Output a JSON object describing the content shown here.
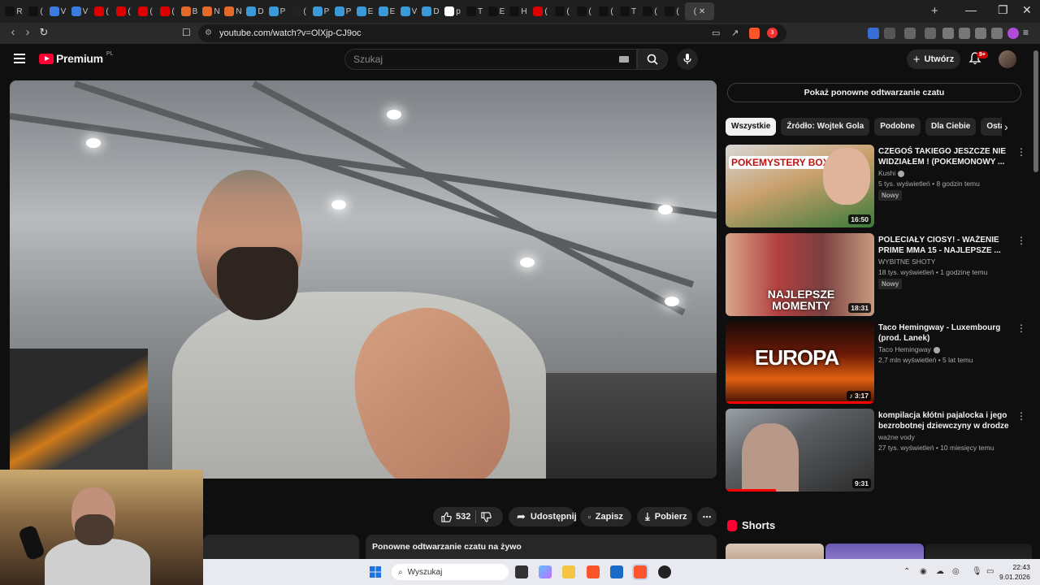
{
  "browser": {
    "active_tab_label": "(",
    "tab_initials": [
      "R",
      "(",
      "V",
      "V",
      "(",
      "(",
      "(",
      "(",
      "B",
      "N",
      "N",
      "D",
      "P",
      "(",
      "P",
      "P",
      "E",
      "E",
      "V",
      "D",
      "p",
      "T",
      "E",
      "H",
      "(",
      "(",
      "(",
      "(",
      "T",
      "(",
      "("
    ],
    "url": "youtube.com/watch?v=OlXjp-CJ9oc",
    "new_tab": "+",
    "win_min": "—",
    "win_max": "❐",
    "win_close": "✕",
    "ext_badge": "3"
  },
  "youtube": {
    "logo_text": "Premium",
    "logo_region": "PL",
    "search_placeholder": "Szukaj",
    "create_label": "Utwórz",
    "notifications_badge": "9+"
  },
  "video_actions": {
    "likes": "532",
    "share_label": "Udostępnij",
    "save_label": "Zapisz",
    "download_label": "Pobierz"
  },
  "chat": {
    "show_replay_button": "Pokaż ponowne odtwarzanie czatu",
    "replay_header": "Ponowne odtwarzanie czatu na żywo"
  },
  "filters": {
    "chips": [
      "Wszystkie",
      "Źródło: Wojtek Gola",
      "Podobne",
      "Dla Ciebie",
      "Ostatnio"
    ],
    "active": 0
  },
  "recommendations": [
    {
      "title": "CZEGOŚ TAKIEGO JESZCZE NIE WIDZIAŁEM ! (POKEMONOWY ...",
      "channel": "Kushi",
      "verified": true,
      "meta": "5 tys. wyświetleń • 8 godzin temu",
      "badge": "Nowy",
      "duration": "16:50",
      "thumb_text": "POKEMYSTERY BOX"
    },
    {
      "title": "POLECIAŁY CIOSY! - WAŻENIE PRIME MMA 15 - NAJLEPSZE ...",
      "channel": "WYBITNE SHOTY",
      "verified": false,
      "meta": "18 tys. wyświetleń • 1 godzinę temu",
      "badge": "Nowy",
      "duration": "18:31",
      "thumb_text": "NAJLEPSZE MOMENTY"
    },
    {
      "title": "Taco Hemingway - Luxembourg (prod. Lanek)",
      "channel": "Taco Hemingway",
      "verified": true,
      "meta": "2,7 mln wyświetleń • 5 lat temu",
      "badge": "",
      "duration": "♪ 3:17",
      "thumb_text": "EUROPA"
    },
    {
      "title": "kompilacja kłótni pajalocka i jego bezrobotnej dziewczyny w drodze do...",
      "channel": "ważne vody",
      "verified": false,
      "meta": "27 tys. wyświetleń • 10 miesięcy temu",
      "badge": "",
      "duration": "9:31",
      "thumb_text": ""
    }
  ],
  "shorts": {
    "label": "Shorts"
  },
  "taskbar": {
    "search_placeholder": "Wyszukaj",
    "time": "22:43",
    "date": "9.01.2026"
  }
}
